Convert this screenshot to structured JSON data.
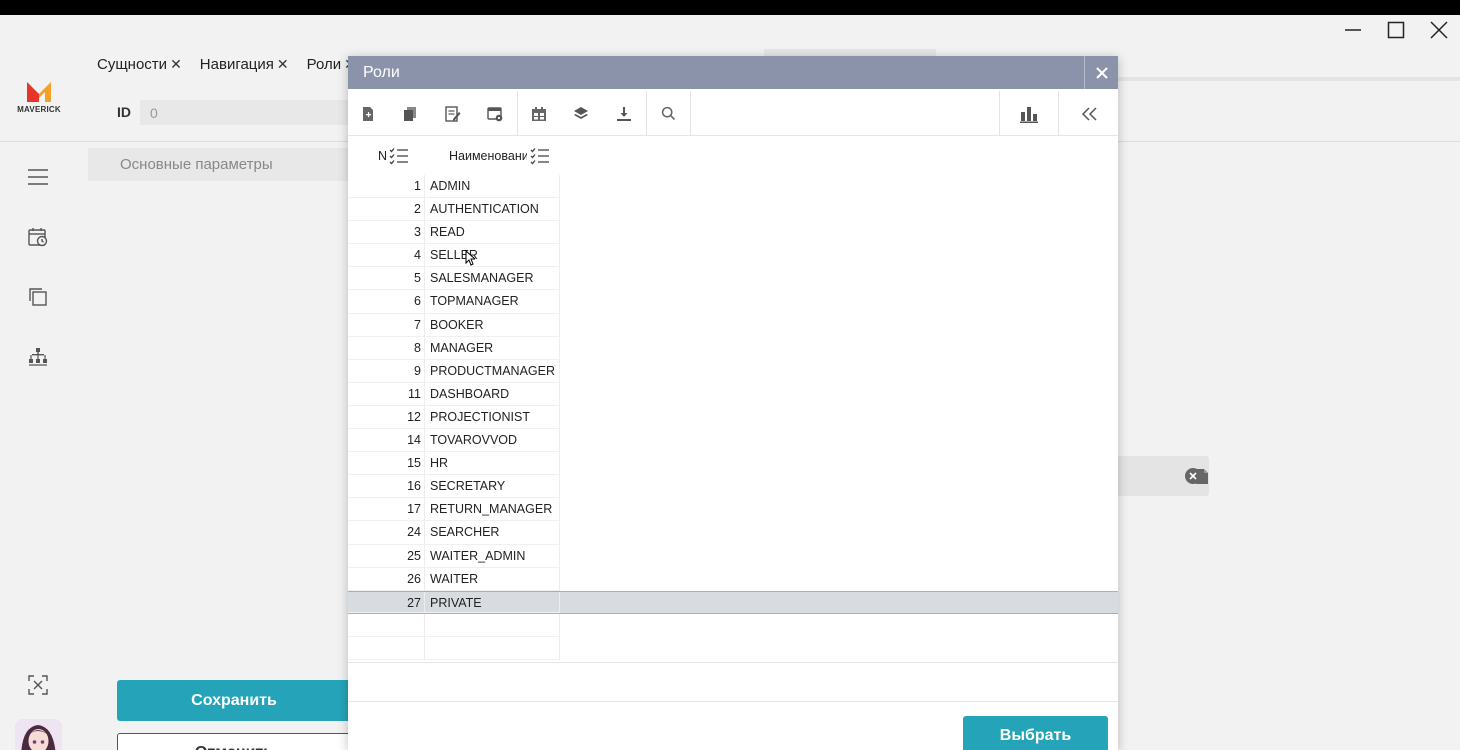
{
  "logo": {
    "text": "MAVERICK",
    "colors": {
      "mark_left": "#e8352b",
      "mark_right": "#f4a12a"
    }
  },
  "tabs": [
    {
      "label": "Сущности",
      "close": "✕"
    },
    {
      "label": "Навигация",
      "close": "✕"
    },
    {
      "label": "Роли",
      "close": "✕"
    }
  ],
  "form": {
    "id_label": "ID",
    "id_value": "0",
    "section_title": "Основные параметры",
    "save_label": "Сохранить",
    "second_label": "Отменить"
  },
  "sidebar_icons": [
    "menu-icon",
    "calendar-clock-icon",
    "copy-icon",
    "hierarchy-icon",
    "collapse-icon"
  ],
  "modal": {
    "title": "Роли",
    "close": "✕",
    "columns": {
      "n": "N",
      "name": "Наименование"
    },
    "rows": [
      {
        "n": "1",
        "name": "ADMIN"
      },
      {
        "n": "2",
        "name": "AUTHENTICATION"
      },
      {
        "n": "3",
        "name": "READ"
      },
      {
        "n": "4",
        "name": "SELLER"
      },
      {
        "n": "5",
        "name": "SALESMANAGER"
      },
      {
        "n": "6",
        "name": "TOPMANAGER"
      },
      {
        "n": "7",
        "name": "BOOKER"
      },
      {
        "n": "8",
        "name": "MANAGER"
      },
      {
        "n": "9",
        "name": "PRODUCTMANAGER"
      },
      {
        "n": "11",
        "name": "DASHBOARD"
      },
      {
        "n": "12",
        "name": "PROJECTIONIST"
      },
      {
        "n": "14",
        "name": "TOVAROVVOD"
      },
      {
        "n": "15",
        "name": "HR"
      },
      {
        "n": "16",
        "name": "SECRETARY"
      },
      {
        "n": "17",
        "name": "RETURN_MANAGER"
      },
      {
        "n": "24",
        "name": "SEARCHER"
      },
      {
        "n": "25",
        "name": "WAITER_ADMIN"
      },
      {
        "n": "26",
        "name": "WAITER"
      },
      {
        "n": "27",
        "name": "PRIVATE"
      }
    ],
    "selected_n": "27",
    "select_label": "Выбрать",
    "toolbar_icons": [
      "new-document-icon",
      "copy-document-icon",
      "edit-document-icon",
      "window-settings-icon",
      "calendar-icon",
      "layers-icon",
      "import-icon",
      "search-icon",
      "chart-icon",
      "double-chevron-left-icon"
    ]
  },
  "colors": {
    "accent": "#25a4b9",
    "modal_header": "#8a93a9",
    "selected_row": "#d8dbe0"
  }
}
